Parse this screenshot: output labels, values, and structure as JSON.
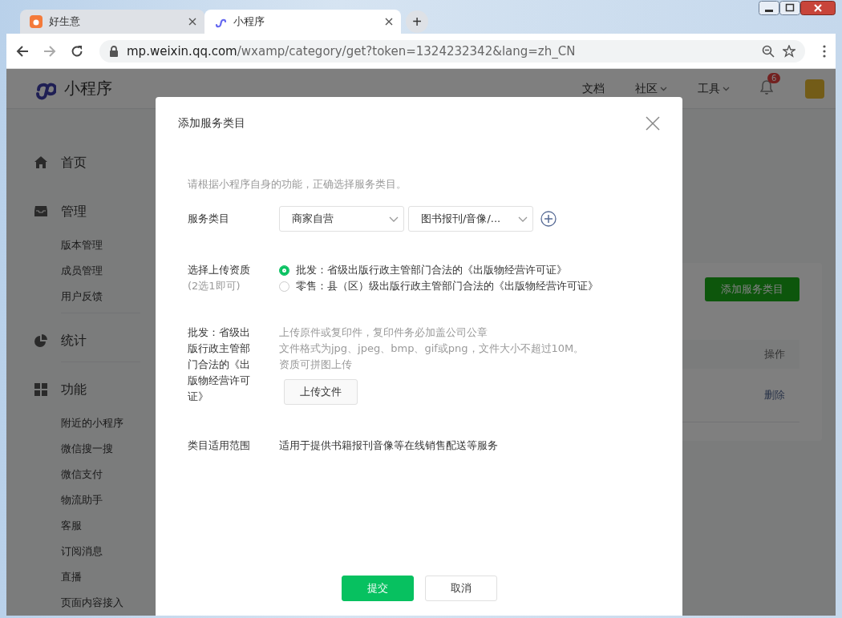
{
  "browser": {
    "tabs": [
      {
        "title": "好生意",
        "selected": false
      },
      {
        "title": "小程序",
        "selected": true
      }
    ],
    "new_tab": "+",
    "address": {
      "host": "mp.weixin.qq.com",
      "path": "/wxamp/category/get?token=1324232342&lang=zh_CN"
    }
  },
  "header": {
    "logo_text": "小程序",
    "nav": [
      {
        "label": "文档",
        "dropdown": false
      },
      {
        "label": "社区",
        "dropdown": true
      },
      {
        "label": "工具",
        "dropdown": true
      }
    ],
    "notification_count": "6"
  },
  "sidebar": {
    "sections": [
      {
        "label": "首页"
      },
      {
        "label": "管理",
        "children": [
          "版本管理",
          "成员管理",
          "用户反馈"
        ]
      },
      {
        "label": "统计"
      },
      {
        "label": "功能",
        "children": [
          "附近的小程序",
          "微信搜一搜",
          "微信支付",
          "物流助手",
          "客服",
          "订阅消息",
          "直播",
          "页面内容接入"
        ]
      }
    ]
  },
  "main": {
    "add_button": "添加服务类目",
    "table": {
      "columns": [
        "操作"
      ],
      "rows": [
        {
          "action": "删除"
        }
      ]
    }
  },
  "modal": {
    "title": "添加服务类目",
    "intro": "请根据小程序自身的功能，正确选择服务类目。",
    "category": {
      "label": "服务类目",
      "selects": [
        "商家自营",
        "图书报刊/音像/..."
      ]
    },
    "qualification": {
      "label": "选择上传资质",
      "sublabel": "(2选1即可)",
      "options": [
        {
          "text": "批发：省级出版行政主管部门合法的《出版物经营许可证》",
          "selected": true
        },
        {
          "text": "零售：县（区）级出版行政主管部门合法的《出版物经营许可证》",
          "selected": false
        }
      ]
    },
    "upload": {
      "label": "批发：省级出版行政主管部门合法的《出版物经营许可证》",
      "hints": [
        "上传原件或复印件，复印件务必加盖公司公章",
        "文件格式为jpg、jpeg、bmp、gif或png，文件大小不超过10M。",
        "资质可拼图上传"
      ],
      "button": "上传文件"
    },
    "scope": {
      "label": "类目适用范围",
      "value": "适用于提供书籍报刊音像等在线销售配送等服务"
    },
    "buttons": [
      {
        "label": "提交",
        "kind": "primary"
      },
      {
        "label": "取消",
        "kind": "default"
      }
    ]
  }
}
